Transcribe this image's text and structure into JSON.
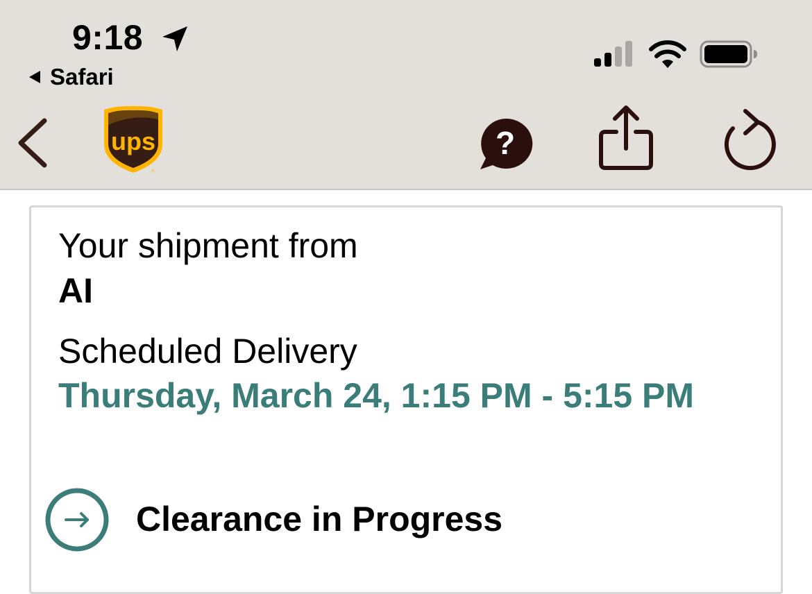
{
  "status_bar": {
    "time": "9:18",
    "back_app": "Safari"
  },
  "nav": {
    "icons": [
      "back-chevron-icon",
      "ups-logo",
      "help-icon",
      "share-icon",
      "refresh-icon"
    ],
    "logo_text": "ups"
  },
  "shipment": {
    "from_label": "Your shipment from",
    "from_name": "AI",
    "scheduled_label": "Scheduled Delivery",
    "scheduled_value": "Thursday, March 24, 1:15 PM - 5:15 PM",
    "status": "Clearance in Progress"
  },
  "colors": {
    "top_bar_bg": "#e3e0dc",
    "ups_brown": "#351c15",
    "ups_gold": "#ffb500",
    "accent_teal": "#3b7d78",
    "card_border": "#d6d6d6"
  }
}
